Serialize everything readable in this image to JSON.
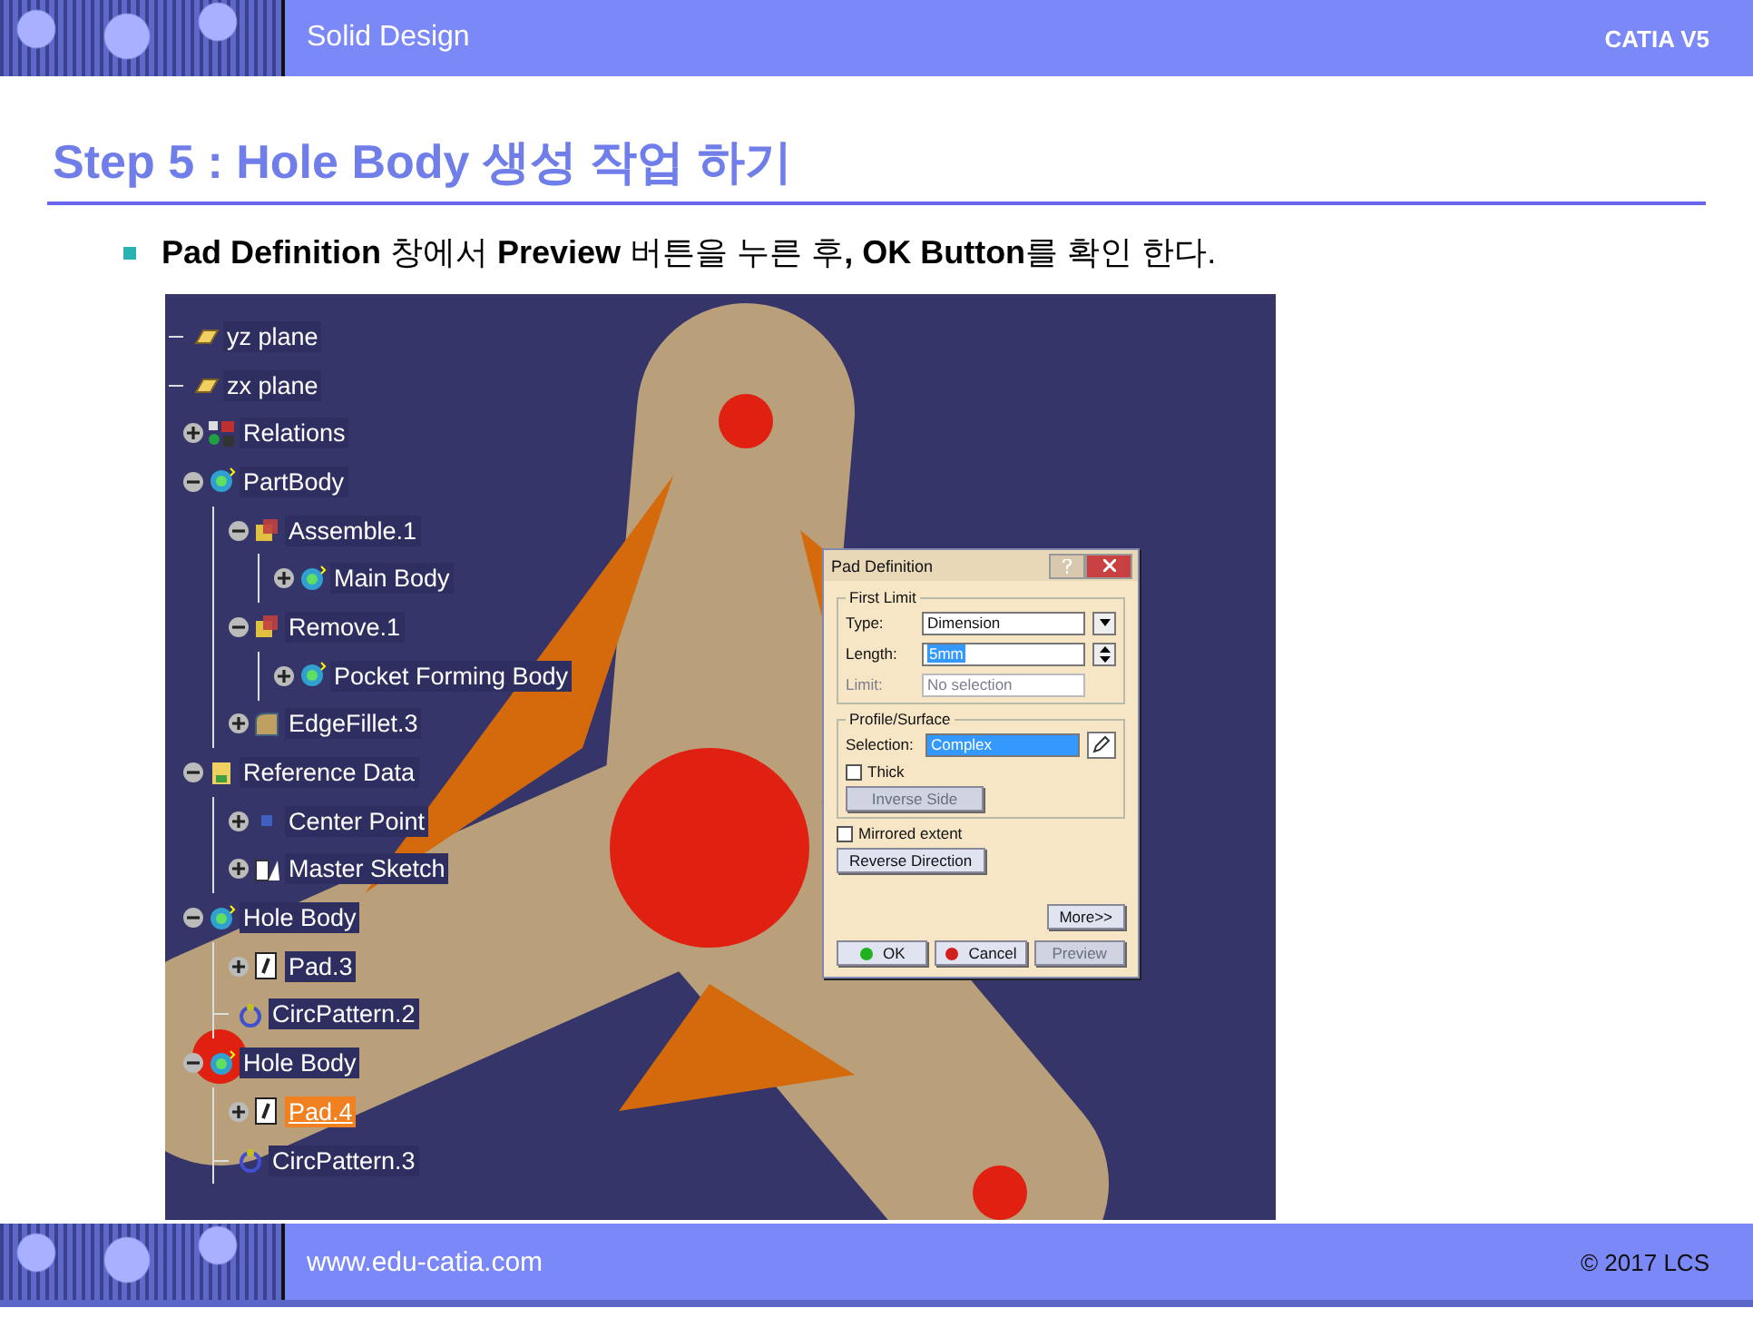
{
  "header": {
    "section": "Solid Design",
    "product": "CATIA V5"
  },
  "title": "Step 5 : Hole Body 생성 작업 하기",
  "bullets": [
    "**Pad Definition** 창에서 **Preview** 버튼을 누른 후**, OK Button**를 확인 한다."
  ],
  "screenshot": {
    "tree": [
      {
        "label": "yz plane",
        "kind": "plane",
        "selected": false
      },
      {
        "label": "zx plane",
        "kind": "plane",
        "selected": false
      },
      {
        "label": "Relations",
        "kind": "relations",
        "expanded": false,
        "selected": false
      },
      {
        "label": "PartBody",
        "kind": "body",
        "expanded": true,
        "selected": false,
        "children": [
          {
            "label": "Assemble.1",
            "kind": "boolean",
            "expanded": true,
            "selected": false,
            "children": [
              {
                "label": "Main Body",
                "kind": "body",
                "expanded": false,
                "selected": false
              }
            ]
          },
          {
            "label": "Remove.1",
            "kind": "boolean",
            "expanded": true,
            "selected": false,
            "children": [
              {
                "label": "Pocket Forming Body",
                "kind": "body",
                "expanded": false,
                "selected": false
              }
            ]
          },
          {
            "label": "EdgeFillet.3",
            "kind": "fillet",
            "expanded": false,
            "selected": false
          }
        ]
      },
      {
        "label": "Reference Data",
        "kind": "reference",
        "expanded": true,
        "selected": false,
        "children": [
          {
            "label": "Center Point",
            "kind": "point",
            "expanded": false,
            "selected": false
          },
          {
            "label": "Master Sketch",
            "kind": "sketch",
            "expanded": false,
            "selected": false
          }
        ]
      },
      {
        "label": "Hole Body",
        "kind": "body",
        "expanded": true,
        "selected": false,
        "children": [
          {
            "label": "Pad.3",
            "kind": "pad",
            "expanded": false,
            "selected": false
          },
          {
            "label": "CircPattern.2",
            "kind": "pattern",
            "selected": false
          }
        ]
      },
      {
        "label": "Hole Body",
        "kind": "body",
        "expanded": true,
        "selected": false,
        "children": [
          {
            "label": "Pad.4",
            "kind": "pad",
            "expanded": false,
            "selected": true
          },
          {
            "label": "CircPattern.3",
            "kind": "pattern",
            "selected": false
          }
        ]
      }
    ],
    "dialog": {
      "title": "Pad Definition",
      "groups": [
        {
          "legend": "First Limit",
          "fields": [
            {
              "label": "Type:",
              "kind": "select",
              "value": "Dimension",
              "disabled": false
            },
            {
              "label": "Length:",
              "kind": "spin",
              "value": "5mm",
              "highlighted": true,
              "disabled": false
            },
            {
              "label": "Limit:",
              "kind": "text",
              "placeholder": "No selection",
              "disabled": true
            }
          ]
        },
        {
          "legend": "Profile/Surface",
          "fields": [
            {
              "label": "Selection:",
              "kind": "pick",
              "value": "Complex",
              "highlighted": true
            },
            {
              "label": "Thick",
              "kind": "checkbox",
              "checked": false,
              "disabled": false
            },
            {
              "label": "Inverse Side",
              "kind": "button",
              "disabled": true
            }
          ]
        }
      ],
      "options": [
        {
          "label": "Mirrored extent",
          "kind": "checkbox",
          "checked": false,
          "disabled": false
        },
        {
          "label": "Reverse Direction",
          "kind": "button",
          "disabled": false
        }
      ],
      "more": "More>>",
      "actions": [
        {
          "label": "OK",
          "kind": "ok",
          "disabled": false
        },
        {
          "label": "Cancel",
          "kind": "cancel",
          "disabled": false
        },
        {
          "label": "Preview",
          "kind": "plain",
          "disabled": true
        }
      ]
    }
  },
  "footer": {
    "url": "www.edu-catia.com",
    "copyright": "© 2017 LCS"
  }
}
